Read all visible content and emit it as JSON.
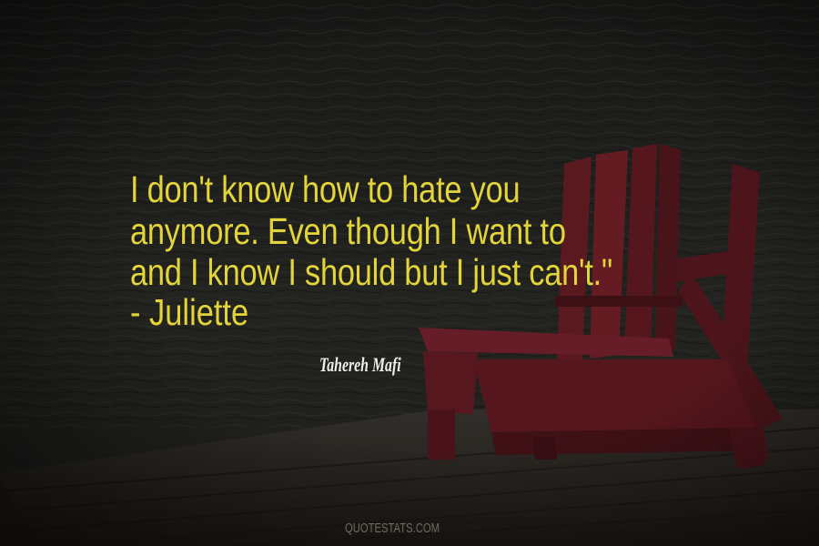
{
  "quote": {
    "lines": [
      "I don't know how to hate you",
      "anymore. Even though I want to",
      "and I know I should but I just can't.\""
    ],
    "attribution": "- Juliette"
  },
  "author": "Tahereh Mafi",
  "watermark": "QUOTESTATS.COM",
  "colors": {
    "quote_text": "#e2d43a",
    "author_text": "#f0f0e8",
    "chairs": "#7a1f26",
    "water": "#2a2b27",
    "dock": "#3a3530"
  }
}
